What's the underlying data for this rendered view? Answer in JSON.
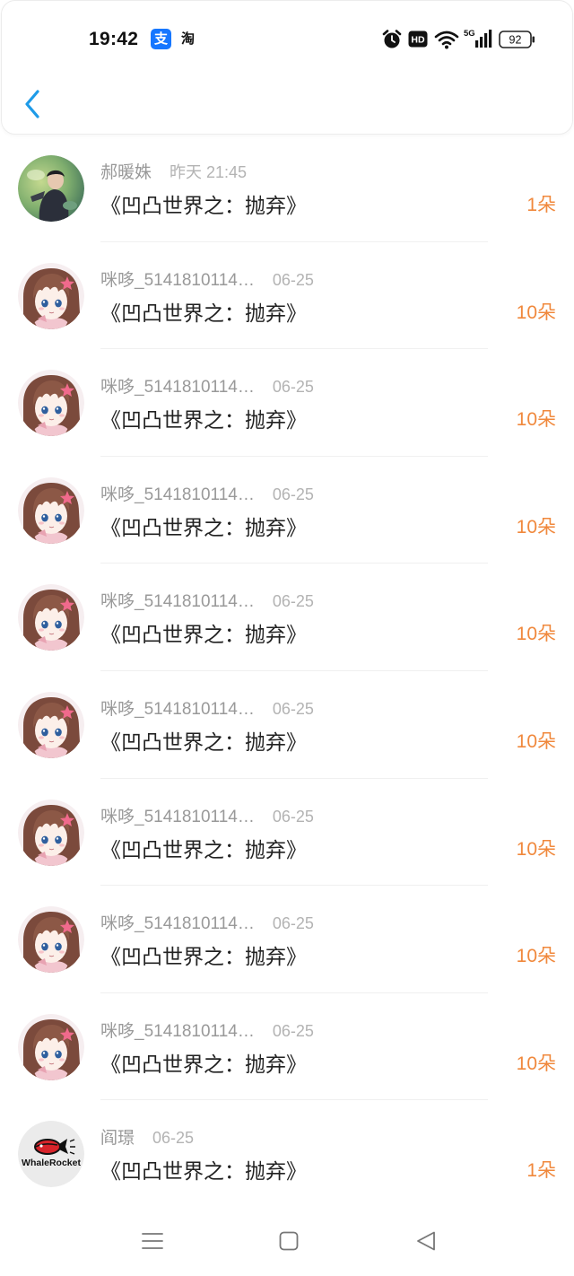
{
  "status_bar": {
    "time": "19:42",
    "alipay_label": "支",
    "taobao_label": "淘",
    "hd_label": "HD",
    "network_label": "5G",
    "battery_level": "92",
    "icons": [
      "alarm-icon",
      "hd-badge-icon",
      "wifi-icon",
      "cellular-signal-icon",
      "battery-icon"
    ]
  },
  "header": {
    "back_icon": "chevron-left-icon"
  },
  "colors": {
    "accent": "#1e9be8",
    "amount": "#f0883c",
    "name": "#999999",
    "time": "#b3b3b3",
    "title": "#222222"
  },
  "gifts": [
    {
      "name": "郝暖姝",
      "time": "昨天 21:45",
      "title": "《凹凸世界之：抛弃》",
      "amount": "1朵",
      "avatar": "photo-avatar"
    },
    {
      "name": "咪哆_5141810114…",
      "time": "06-25",
      "title": "《凹凸世界之：抛弃》",
      "amount": "10朵",
      "avatar": "anime-girl-avatar"
    },
    {
      "name": "咪哆_5141810114…",
      "time": "06-25",
      "title": "《凹凸世界之：抛弃》",
      "amount": "10朵",
      "avatar": "anime-girl-avatar"
    },
    {
      "name": "咪哆_5141810114…",
      "time": "06-25",
      "title": "《凹凸世界之：抛弃》",
      "amount": "10朵",
      "avatar": "anime-girl-avatar"
    },
    {
      "name": "咪哆_5141810114…",
      "time": "06-25",
      "title": "《凹凸世界之：抛弃》",
      "amount": "10朵",
      "avatar": "anime-girl-avatar"
    },
    {
      "name": "咪哆_5141810114…",
      "time": "06-25",
      "title": "《凹凸世界之：抛弃》",
      "amount": "10朵",
      "avatar": "anime-girl-avatar"
    },
    {
      "name": "咪哆_5141810114…",
      "time": "06-25",
      "title": "《凹凸世界之：抛弃》",
      "amount": "10朵",
      "avatar": "anime-girl-avatar"
    },
    {
      "name": "咪哆_5141810114…",
      "time": "06-25",
      "title": "《凹凸世界之：抛弃》",
      "amount": "10朵",
      "avatar": "anime-girl-avatar"
    },
    {
      "name": "咪哆_5141810114…",
      "time": "06-25",
      "title": "《凹凸世界之：抛弃》",
      "amount": "10朵",
      "avatar": "anime-girl-avatar"
    },
    {
      "name": "阎璟",
      "time": "06-25",
      "title": "《凹凸世界之：抛弃》",
      "amount": "1朵",
      "avatar": "whalerocket-logo-avatar",
      "logo_text": "WhaleRocket"
    }
  ],
  "nav_bar": {
    "icons": [
      "menu-icon",
      "home-square-icon",
      "back-triangle-icon"
    ]
  }
}
